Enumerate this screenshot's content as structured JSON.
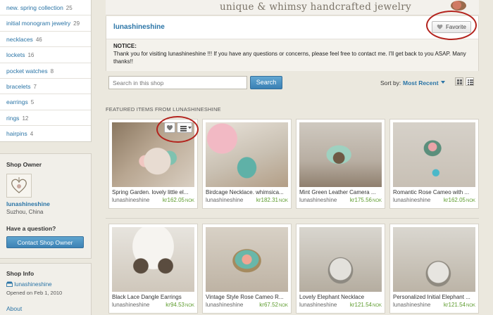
{
  "sidebar": {
    "categories": [
      {
        "label": "new. spring collection",
        "count": "25"
      },
      {
        "label": "initial monogram jewelry",
        "count": "29"
      },
      {
        "label": "necklaces",
        "count": "46"
      },
      {
        "label": "lockets",
        "count": "16"
      },
      {
        "label": "pocket watches",
        "count": "8"
      },
      {
        "label": "bracelets",
        "count": "7"
      },
      {
        "label": "earrings",
        "count": "5"
      },
      {
        "label": "rings",
        "count": "12"
      },
      {
        "label": "hairpins",
        "count": "4"
      }
    ],
    "owner": {
      "heading": "Shop Owner",
      "name": "lunashineshine",
      "location": "Suzhou, China",
      "question": "Have a question?",
      "contact_label": "Contact Shop Owner"
    },
    "info": {
      "heading": "Shop Info",
      "shop_link": "lunashineshine",
      "opened": "Opened on Feb 1, 2010",
      "about": "About"
    }
  },
  "banner": {
    "tagline": "unique & whimsy handcrafted jewelry"
  },
  "shop": {
    "name": "lunashineshine",
    "favorite_label": "Favorite",
    "notice_title": "NOTICE:",
    "notice_text": "Thank you for visiting lunashineshine !!! If you have any questions or concerns, please feel free to contact me. I'll get back to you ASAP. Many thanks!!"
  },
  "search": {
    "placeholder": "Search in this shop",
    "button_label": "Search"
  },
  "sort": {
    "label": "Sort by:",
    "value": "Most Recent"
  },
  "featured_heading": "FEATURED ITEMS FROM LUNASHINESHINE",
  "items": [
    {
      "title": "Spring Garden. lovely little el...",
      "shop": "lunashineshine",
      "price": "kr162.05",
      "currency": "NOK"
    },
    {
      "title": "Birdcage Necklace. whimsica...",
      "shop": "lunashineshine",
      "price": "kr182.31",
      "currency": "NOK"
    },
    {
      "title": "Mint Green Leather Camera ...",
      "shop": "lunashineshine",
      "price": "kr175.56",
      "currency": "NOK"
    },
    {
      "title": "Romantic Rose Cameo with ...",
      "shop": "lunashineshine",
      "price": "kr162.05",
      "currency": "NOK"
    },
    {
      "title": "Black Lace Dangle Earrings",
      "shop": "lunashineshine",
      "price": "kr94.53",
      "currency": "NOK"
    },
    {
      "title": "Vintage Style Rose Cameo R...",
      "shop": "lunashineshine",
      "price": "kr67.52",
      "currency": "NOK"
    },
    {
      "title": "Lovely Elephant Necklace",
      "shop": "lunashineshine",
      "price": "kr121.54",
      "currency": "NOK"
    },
    {
      "title": "Personalized Initial Elephant ...",
      "shop": "lunashineshine",
      "price": "kr121.54",
      "currency": "NOK"
    }
  ],
  "colors": {
    "link": "#2a74a6",
    "price": "#5d9b2d",
    "button": "#3d82b5",
    "highlight_circle": "#b3231d"
  },
  "icons": [
    "heart-icon",
    "menu-icon",
    "shop-icon",
    "grid-view-icon",
    "list-view-icon",
    "sort-arrow-icon"
  ]
}
